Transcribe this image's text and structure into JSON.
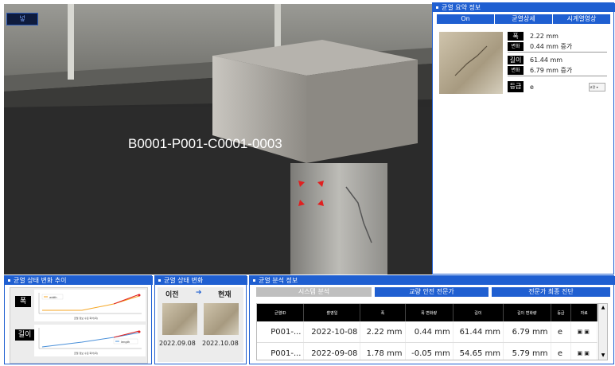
{
  "viewer": {
    "mini_label": "넣",
    "element_id": "B0001-P001-C0001-0003"
  },
  "summary": {
    "title": "균열 요약 정보",
    "tabs": [
      "On",
      "균열상세",
      "시계열영상"
    ],
    "width_label": "폭",
    "width_value": "2.22 mm",
    "width_change_label": "변화",
    "width_change_value": "0.44 mm 증가",
    "length_label": "길이",
    "length_value": "61.44 mm",
    "length_change_label": "변화",
    "length_change_value": "6.79 mm 증가",
    "grade_label": "등급",
    "grade_value": "e",
    "grade_select": "교량"
  },
  "trend": {
    "title": "균열 상태 변화 추이",
    "width_label": "폭",
    "length_label": "길이",
    "width_chart_xlabel": "균열 정보 수집 회차(회)",
    "length_chart_xlabel": "균열 정보 수집 회차(회)",
    "width_legend": "width",
    "length_legend": "length"
  },
  "change": {
    "title": "균열 상태 변화",
    "before_label": "이전",
    "after_label": "현재",
    "arrow": "➔",
    "before_date": "2022.09.08",
    "after_date": "2022.10.08"
  },
  "analysis": {
    "title": "균열 분석 정보",
    "tabs": [
      "시스템 분석",
      "교량 안전 전문가",
      "전문가 최종 진단"
    ],
    "columns": [
      "균열ID",
      "촬영일",
      "폭",
      "폭 변화량",
      "길이",
      "길이 변화량",
      "등급",
      "자료"
    ],
    "rows": [
      {
        "id": "P001-...",
        "date": "2022-10-08",
        "width": "2.22 mm",
        "width_change": "0.44 mm",
        "length": "61.44 mm",
        "length_change": "6.79 mm",
        "grade": "e"
      },
      {
        "id": "P001-...",
        "date": "2022-09-08",
        "width": "1.78 mm",
        "width_change": "-0.05 mm",
        "length": "54.65 mm",
        "length_change": "5.79 mm",
        "grade": "e"
      }
    ]
  },
  "colors": {
    "accent": "#1f5fd1",
    "marker": "#e02020",
    "width_line": "#f5a623",
    "length_line": "#4a90d9"
  }
}
